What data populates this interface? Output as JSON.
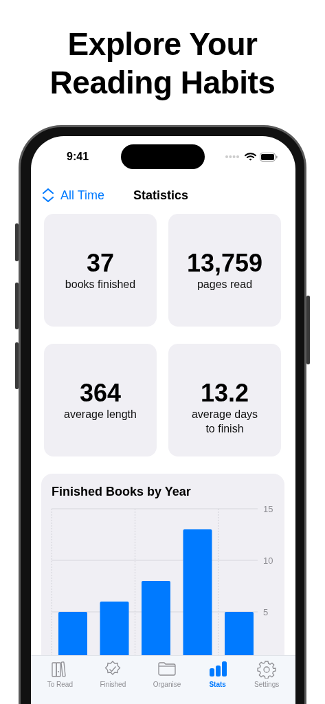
{
  "headline": [
    "Explore Your",
    "Reading Habits"
  ],
  "status_bar": {
    "time": "9:41"
  },
  "nav": {
    "filter": "All Time",
    "title": "Statistics"
  },
  "stats": [
    {
      "value": "37",
      "label": "books finished"
    },
    {
      "value": "13,759",
      "label": "pages read"
    },
    {
      "value": "364",
      "label": "average length"
    },
    {
      "value": "13.2",
      "label": "average days to finish"
    }
  ],
  "chart": {
    "title": "Finished Books by Year",
    "chart_data": {
      "type": "bar",
      "values": [
        5,
        6,
        8,
        13,
        5
      ],
      "ylim": [
        0,
        15
      ],
      "yticks": [
        5,
        10,
        15
      ]
    }
  },
  "tabs": [
    {
      "label": "To Read",
      "kind": "books",
      "selected": false
    },
    {
      "label": "Finished",
      "kind": "seal",
      "selected": false
    },
    {
      "label": "Organise",
      "kind": "folder",
      "selected": false
    },
    {
      "label": "Stats",
      "kind": "bars",
      "selected": true
    },
    {
      "label": "Settings",
      "kind": "gear",
      "selected": false
    }
  ]
}
